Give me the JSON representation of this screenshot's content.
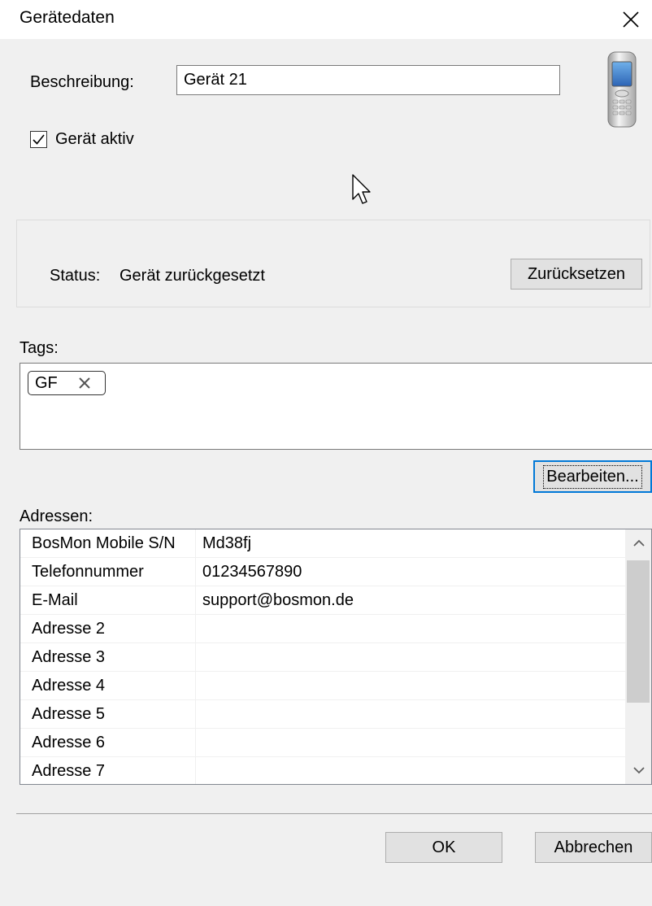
{
  "window": {
    "title": "Gerätedaten",
    "close_icon": "close-icon"
  },
  "device": {
    "description_label": "Beschreibung:",
    "description_value": "Gerät 21",
    "active_label": "Gerät aktiv",
    "active_checked": true,
    "device_icon": "mobile-phone-icon"
  },
  "status": {
    "label": "Status:",
    "value": "Gerät zurückgesetzt",
    "reset_button": "Zurücksetzen"
  },
  "tags": {
    "label": "Tags:",
    "items": [
      {
        "label": "GF",
        "remove_icon": "remove-tag-icon"
      }
    ],
    "edit_button": "Bearbeiten..."
  },
  "addresses": {
    "label": "Adressen:",
    "rows": [
      {
        "name": "BosMon Mobile S/N",
        "value": "Md38fj"
      },
      {
        "name": "Telefonnummer",
        "value": "01234567890"
      },
      {
        "name": "E-Mail",
        "value": "support@bosmon.de"
      },
      {
        "name": "Adresse 2",
        "value": ""
      },
      {
        "name": "Adresse 3",
        "value": ""
      },
      {
        "name": "Adresse 4",
        "value": ""
      },
      {
        "name": "Adresse 5",
        "value": ""
      },
      {
        "name": "Adresse 6",
        "value": ""
      },
      {
        "name": "Adresse 7",
        "value": ""
      }
    ]
  },
  "footer": {
    "ok_button": "OK",
    "cancel_button": "Abbrechen"
  },
  "colors": {
    "dialog_bg": "#f0f0f0",
    "focus_border": "#0078d7",
    "button_bg": "#e1e1e1"
  }
}
